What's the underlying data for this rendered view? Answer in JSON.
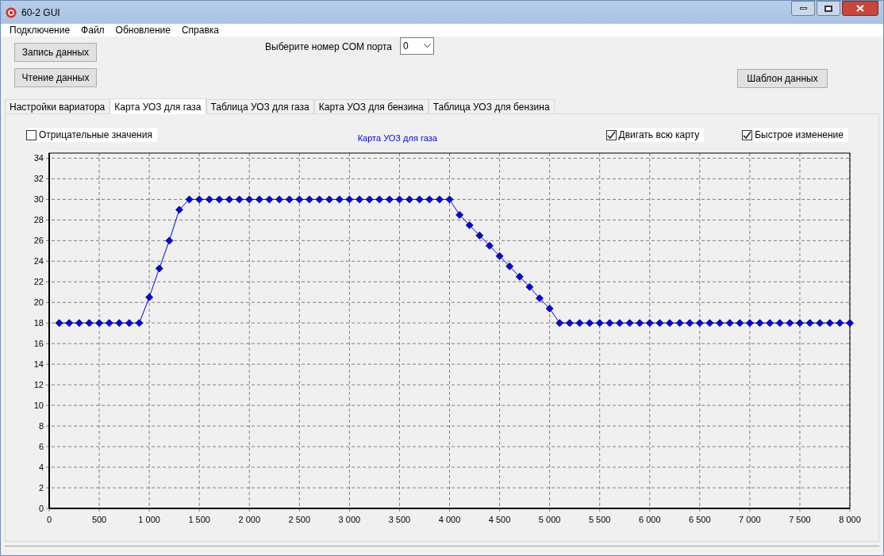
{
  "window": {
    "title": "60-2 GUI"
  },
  "menu": [
    "Подключение",
    "Файл",
    "Обновление",
    "Справка"
  ],
  "buttons": {
    "write": "Запись данных",
    "read": "Чтение данных",
    "template": "Шаблон данных"
  },
  "com_port": {
    "label": "Выберите номер COM порта",
    "value": "0"
  },
  "tabs": [
    {
      "label": "Настройки вариатора",
      "selected": false
    },
    {
      "label": "Карта УОЗ для газа",
      "selected": true
    },
    {
      "label": "Таблица УОЗ для газа",
      "selected": false
    },
    {
      "label": "Карта УОЗ для бензина",
      "selected": false
    },
    {
      "label": "Таблица УОЗ для бензина",
      "selected": false
    }
  ],
  "options": [
    {
      "label": "Отрицательные значения",
      "checked": false
    },
    {
      "label": "Двигать всю карту",
      "checked": true
    },
    {
      "label": "Быстрое изменение",
      "checked": true
    }
  ],
  "chart": {
    "chart_data": {
      "type": "line",
      "title": "Карта УОЗ для газа",
      "x": [
        100,
        200,
        300,
        400,
        500,
        600,
        700,
        800,
        900,
        1000,
        1100,
        1200,
        1300,
        1400,
        1500,
        1600,
        1700,
        1800,
        1900,
        2000,
        2100,
        2200,
        2300,
        2400,
        2500,
        2600,
        2700,
        2800,
        2900,
        3000,
        3100,
        3200,
        3300,
        3400,
        3500,
        3600,
        3700,
        3800,
        3900,
        4000,
        4100,
        4200,
        4300,
        4400,
        4500,
        4600,
        4700,
        4800,
        4900,
        5000,
        5100,
        5200,
        5300,
        5400,
        5500,
        5600,
        5700,
        5800,
        5900,
        6000,
        6100,
        6200,
        6300,
        6400,
        6500,
        6600,
        6700,
        6800,
        6900,
        7000,
        7100,
        7200,
        7300,
        7400,
        7500,
        7600,
        7700,
        7800,
        7900,
        8000
      ],
      "grid": true,
      "series": [
        {
          "color": "#0000ff",
          "marker": "diamond",
          "values": [
            18,
            18,
            18,
            18,
            18,
            18,
            18,
            18,
            18,
            20.5,
            23.3,
            26,
            29,
            30,
            30,
            30,
            30,
            30,
            30,
            30,
            30,
            30,
            30,
            30,
            30,
            30,
            30,
            30,
            30,
            30,
            30,
            30,
            30,
            30,
            30,
            30,
            30,
            30,
            30,
            30,
            28.5,
            27.5,
            26.5,
            25.5,
            24.5,
            23.5,
            22.5,
            21.5,
            20.4,
            19.4,
            18,
            18,
            18,
            18,
            18,
            18,
            18,
            18,
            18,
            18,
            18,
            18,
            18,
            18,
            18,
            18,
            18,
            18,
            18,
            18,
            18,
            18,
            18,
            18,
            18,
            18,
            18,
            18,
            18,
            18
          ]
        }
      ],
      "xlim": [
        0,
        8000
      ],
      "ylim": [
        0,
        34.5
      ],
      "xticks": [
        0,
        500,
        {
          "value": 1000,
          "label": "1 000"
        },
        {
          "value": 1500,
          "label": "1 500"
        },
        {
          "value": 2000,
          "label": "2 000"
        },
        {
          "value": 2500,
          "label": "2 500"
        },
        {
          "value": 3000,
          "label": "3 000"
        },
        {
          "value": 3500,
          "label": "3 500"
        },
        {
          "value": 4000,
          "label": "4 000"
        },
        {
          "value": 4500,
          "label": "4 500"
        },
        {
          "value": 5000,
          "label": "5 000"
        },
        {
          "value": 5500,
          "label": "5 500"
        },
        {
          "value": 6000,
          "label": "6 000"
        },
        {
          "value": 6500,
          "label": "6 500"
        },
        {
          "value": 7000,
          "label": "7 000"
        },
        {
          "value": 7500,
          "label": "7 500"
        },
        {
          "value": 8000,
          "label": "8 000"
        }
      ],
      "yticks": [
        0,
        2,
        4,
        6,
        8,
        10,
        12,
        14,
        16,
        18,
        20,
        22,
        24,
        26,
        28,
        30,
        32,
        34
      ]
    }
  }
}
